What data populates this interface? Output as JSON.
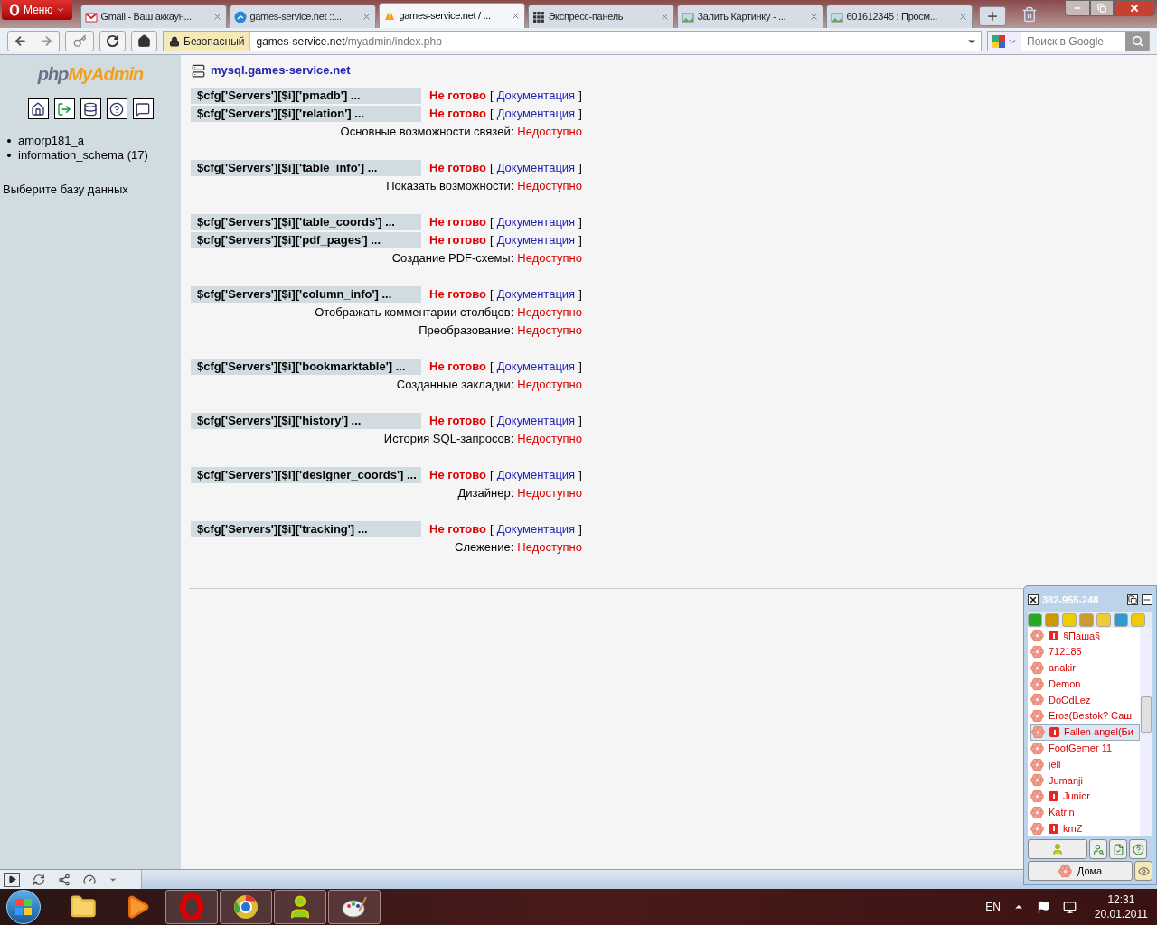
{
  "browser": {
    "menu": "Меню",
    "tabs": [
      {
        "title": "Gmail - Ваш аккаун...",
        "selected": false
      },
      {
        "title": "games-service.net ::...",
        "selected": false
      },
      {
        "title": "games-service.net / ...",
        "selected": true
      },
      {
        "title": "Экспресс-панель",
        "selected": false
      },
      {
        "title": "Залить Картинку - ...",
        "selected": false
      },
      {
        "title": "601612345 : Просм...",
        "selected": false
      }
    ],
    "security": "Безопасный",
    "address_host": "games-service.net",
    "address_path": "/myadmin/index.php",
    "search": {
      "placeholder": "Поиск в Google"
    }
  },
  "sidebar": {
    "logo_php": "php",
    "logo_name": "MyAdmin",
    "databases": [
      "amorp181_a",
      "information_schema (17)"
    ],
    "hint": "Выберите базу данных"
  },
  "main": {
    "server": "mysql.games-service.net",
    "groups": [
      {
        "checks": [
          {
            "setting": "$cfg['Servers'][$i]['pmadb'] ...",
            "status": "Не готово",
            "open": "[",
            "link": "Документация",
            "close": "]"
          },
          {
            "setting": "$cfg['Servers'][$i]['relation'] ...",
            "status": "Не готово",
            "open": "[",
            "link": "Документация",
            "close": "]"
          }
        ],
        "features": [
          {
            "label": "Основные возможности связей:",
            "status": "Недоступно"
          }
        ]
      },
      {
        "checks": [
          {
            "setting": "$cfg['Servers'][$i]['table_info'] ...",
            "status": "Не готово",
            "open": "[",
            "link": "Документация",
            "close": "]"
          }
        ],
        "features": [
          {
            "label": "Показать возможности:",
            "status": "Недоступно"
          }
        ]
      },
      {
        "checks": [
          {
            "setting": "$cfg['Servers'][$i]['table_coords'] ...",
            "status": "Не готово",
            "open": "[",
            "link": "Документация",
            "close": "]"
          },
          {
            "setting": "$cfg['Servers'][$i]['pdf_pages'] ...",
            "status": "Не готово",
            "open": "[",
            "link": "Документация",
            "close": "]"
          }
        ],
        "features": [
          {
            "label": "Создание PDF-схемы:",
            "status": "Недоступно"
          }
        ]
      },
      {
        "checks": [
          {
            "setting": "$cfg['Servers'][$i]['column_info'] ...",
            "status": "Не готово",
            "open": "[",
            "link": "Документация",
            "close": "]"
          }
        ],
        "features": [
          {
            "label": "Отображать комментарии столбцов:",
            "status": "Недоступно"
          },
          {
            "label": "Преобразование:",
            "status": "Недоступно"
          }
        ]
      },
      {
        "checks": [
          {
            "setting": "$cfg['Servers'][$i]['bookmarktable'] ...",
            "status": "Не готово",
            "open": "[",
            "link": "Документация",
            "close": "]"
          }
        ],
        "features": [
          {
            "label": "Созданные закладки:",
            "status": "Недоступно"
          }
        ]
      },
      {
        "checks": [
          {
            "setting": "$cfg['Servers'][$i]['history'] ...",
            "status": "Не готово",
            "open": "[",
            "link": "Документация",
            "close": "]"
          }
        ],
        "features": [
          {
            "label": "История SQL-запросов:",
            "status": "Недоступно"
          }
        ]
      },
      {
        "checks": [
          {
            "setting": "$cfg['Servers'][$i]['designer_coords'] ...",
            "status": "Не готово",
            "open": "[",
            "link": "Документация",
            "close": "]"
          }
        ],
        "features": [
          {
            "label": "Дизайнер:",
            "status": "Недоступно"
          }
        ]
      },
      {
        "checks": [
          {
            "setting": "$cfg['Servers'][$i]['tracking'] ...",
            "status": "Не готово",
            "open": "[",
            "link": "Документация",
            "close": "]"
          }
        ],
        "features": [
          {
            "label": "Слежение:",
            "status": "Недоступно"
          }
        ]
      }
    ]
  },
  "messenger": {
    "title": "382-955-248",
    "contacts": [
      {
        "name": "§Паша§",
        "alert": true,
        "selected": false
      },
      {
        "name": "712185",
        "alert": false,
        "selected": false
      },
      {
        "name": "anakir",
        "alert": false,
        "selected": false
      },
      {
        "name": "Demon",
        "alert": false,
        "selected": false
      },
      {
        "name": "DoOdLez",
        "alert": false,
        "selected": false
      },
      {
        "name": "Eros(Bestok? Саш",
        "alert": false,
        "selected": false
      },
      {
        "name": "Fallen angel(Би",
        "alert": true,
        "selected": true
      },
      {
        "name": "FootGemer 11",
        "alert": false,
        "selected": false
      },
      {
        "name": "jell",
        "alert": false,
        "selected": false
      },
      {
        "name": "Jumanji",
        "alert": false,
        "selected": false
      },
      {
        "name": "Junior",
        "alert": true,
        "selected": false
      },
      {
        "name": "Katrin",
        "alert": false,
        "selected": false
      },
      {
        "name": "kmZ",
        "alert": true,
        "selected": false
      }
    ],
    "status_button": "Дома"
  },
  "taskbar": {
    "apps": [
      {
        "running": false
      },
      {
        "running": false
      },
      {
        "running": true
      },
      {
        "running": true
      },
      {
        "running": true
      },
      {
        "running": true
      }
    ],
    "language": "EN",
    "time": "12:31",
    "date": "20.01.2011"
  }
}
